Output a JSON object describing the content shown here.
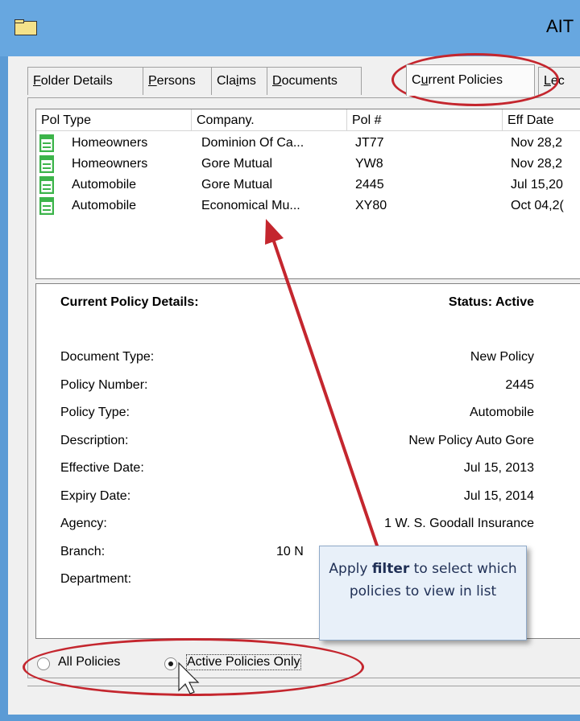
{
  "window": {
    "title": "AIT"
  },
  "tabs": [
    {
      "label": "Folder Details",
      "accel_index": 0,
      "active": false
    },
    {
      "label": "Persons",
      "accel_index": 0,
      "active": false
    },
    {
      "label": "Claims",
      "accel_index": 3,
      "active": false
    },
    {
      "label": "Documents",
      "accel_index": 0,
      "active": false
    },
    {
      "label": "Current Policies",
      "accel_index": 1,
      "active": true
    },
    {
      "label": "Lec",
      "accel_index": 0,
      "active": false
    }
  ],
  "policy_list": {
    "columns": [
      "Pol Type",
      "Company.",
      "Pol #",
      "Eff Date"
    ],
    "rows": [
      {
        "pol_type": "Homeowners",
        "company": "Dominion Of Ca...",
        "pol_num": "JT77",
        "eff_date": "Nov 28,2"
      },
      {
        "pol_type": "Homeowners",
        "company": "Gore Mutual",
        "pol_num": "YW8",
        "eff_date": "Nov 28,2"
      },
      {
        "pol_type": "Automobile",
        "company": "Gore Mutual",
        "pol_num": "2445",
        "eff_date": "Jul 15,20"
      },
      {
        "pol_type": "Automobile",
        "company": "Economical Mu...",
        "pol_num": "XY80",
        "eff_date": "Oct 04,2("
      }
    ],
    "row_icon": "document-icon"
  },
  "details": {
    "heading": "Current Policy Details:",
    "status": "Status: Active",
    "fields": [
      {
        "label": "Document Type:",
        "value": "New Policy"
      },
      {
        "label": "Policy Number:",
        "value": "2445"
      },
      {
        "label": "Policy Type:",
        "value": "Automobile"
      },
      {
        "label": "Description:",
        "value": "New Policy Auto Gore"
      },
      {
        "label": "Effective Date:",
        "value": "Jul 15, 2013"
      },
      {
        "label": "Expiry Date:",
        "value": "Jul 15, 2014"
      },
      {
        "label": "Agency:",
        "value": "1 W. S. Goodall Insurance"
      },
      {
        "label": "Branch:",
        "value": "10 N"
      },
      {
        "label": "Department:",
        "value": ""
      }
    ]
  },
  "filter": {
    "all_label": "All Policies",
    "active_label": "Active Policies Only",
    "selected": "active"
  },
  "callout": {
    "text_before": "Apply ",
    "text_bold": "filter",
    "text_after": " to select which policies to view in list"
  },
  "colors": {
    "annotation_red": "#c4262e",
    "title_bar": "#67a7e0",
    "callout_bg": "#e8f0f9",
    "icon_green": "#3cb44a"
  }
}
